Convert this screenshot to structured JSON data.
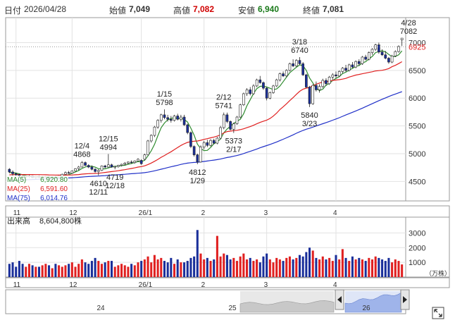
{
  "header": {
    "date_label": "日付",
    "date": "2026/04/28",
    "open_label": "始値",
    "open": "7,049",
    "high_label": "高値",
    "high": "7,082",
    "low_label": "安値",
    "low": "6,940",
    "close_label": "終値",
    "close": "7,081"
  },
  "colors": {
    "ma5": "#2e8b2e",
    "ma25": "#e02020",
    "ma75": "#2030c8",
    "up_candle": "#ffffff",
    "down_candle": "#1a2f9a",
    "volume_up": "#e02020",
    "volume_down": "#1a2f9a",
    "current_price": "#e02020"
  },
  "legend": [
    {
      "label": "MA(5)",
      "value": "6,920.80",
      "color": "#2e8b2e"
    },
    {
      "label": "MA(25)",
      "value": "6,591.60",
      "color": "#e02020"
    },
    {
      "label": "MA(75)",
      "value": "6,014.76",
      "color": "#2030c8"
    }
  ],
  "current_price_label": "6925",
  "volume_label": "出来高",
  "volume_value": "8,604,800株",
  "volume_unit": "（万株）",
  "navigator": {
    "labels": [
      "24",
      "25",
      "26"
    ]
  },
  "chart_data": {
    "type": "candlestick",
    "price_axis": {
      "ticks": [
        4500,
        5000,
        5500,
        6000,
        6500,
        7000
      ],
      "range": [
        4150,
        7450
      ]
    },
    "volume_axis": {
      "ticks": [
        1000,
        2000,
        3000
      ],
      "range": [
        0,
        3500
      ],
      "unit": "万株"
    },
    "x_axis": {
      "tick_labels": [
        {
          "label": "11",
          "index": 2
        },
        {
          "label": "12",
          "index": 19
        },
        {
          "label": "26/1",
          "index": 40
        },
        {
          "label": "2",
          "index": 59
        },
        {
          "label": "3",
          "index": 78
        },
        {
          "label": "4",
          "index": 99
        }
      ]
    },
    "annotations": [
      {
        "index": 22,
        "price": 4868,
        "date": "12/4",
        "type": "high"
      },
      {
        "index": 30,
        "price": 4994,
        "date": "12/15",
        "type": "high"
      },
      {
        "index": 27,
        "price": 4610,
        "date": "12/11",
        "type": "low"
      },
      {
        "index": 32,
        "price": 4719,
        "date": "12/18",
        "type": "low"
      },
      {
        "index": 47,
        "price": 5798,
        "date": "1/15",
        "type": "high"
      },
      {
        "index": 57,
        "price": 4812,
        "date": "1/29",
        "type": "low"
      },
      {
        "index": 65,
        "price": 5741,
        "date": "2/12",
        "type": "high"
      },
      {
        "index": 68,
        "price": 5373,
        "date": "2/17",
        "type": "low"
      },
      {
        "index": 88,
        "price": 6740,
        "date": "3/18",
        "type": "high"
      },
      {
        "index": 91,
        "price": 5840,
        "date": "3/23",
        "type": "low"
      },
      {
        "index": 121,
        "price": 7082,
        "date": "4/28",
        "type": "high"
      }
    ],
    "series": [
      {
        "name": "MA(5)",
        "values": []
      },
      {
        "name": "MA(25)",
        "values": []
      },
      {
        "name": "MA(75)",
        "values": []
      }
    ],
    "candles": [
      {
        "o": 4720,
        "h": 4740,
        "l": 4650,
        "c": 4670,
        "v": 900
      },
      {
        "o": 4670,
        "h": 4700,
        "l": 4600,
        "c": 4640,
        "v": 1000
      },
      {
        "o": 4640,
        "h": 4660,
        "l": 4590,
        "c": 4620,
        "v": 700
      },
      {
        "o": 4620,
        "h": 4640,
        "l": 4570,
        "c": 4590,
        "v": 1100
      },
      {
        "o": 4590,
        "h": 4610,
        "l": 4550,
        "c": 4580,
        "v": 900
      },
      {
        "o": 4580,
        "h": 4600,
        "l": 4560,
        "c": 4590,
        "v": 700
      },
      {
        "o": 4590,
        "h": 4620,
        "l": 4560,
        "c": 4600,
        "v": 900
      },
      {
        "o": 4600,
        "h": 4610,
        "l": 4560,
        "c": 4570,
        "v": 800
      },
      {
        "o": 4570,
        "h": 4600,
        "l": 4550,
        "c": 4590,
        "v": 700
      },
      {
        "o": 4590,
        "h": 4610,
        "l": 4560,
        "c": 4575,
        "v": 700
      },
      {
        "o": 4575,
        "h": 4600,
        "l": 4555,
        "c": 4580,
        "v": 800
      },
      {
        "o": 4580,
        "h": 4600,
        "l": 4560,
        "c": 4585,
        "v": 900
      },
      {
        "o": 4585,
        "h": 4600,
        "l": 4560,
        "c": 4570,
        "v": 800
      },
      {
        "o": 4570,
        "h": 4590,
        "l": 4550,
        "c": 4580,
        "v": 600
      },
      {
        "o": 4580,
        "h": 4600,
        "l": 4560,
        "c": 4575,
        "v": 900
      },
      {
        "o": 4575,
        "h": 4610,
        "l": 4560,
        "c": 4600,
        "v": 800
      },
      {
        "o": 4600,
        "h": 4640,
        "l": 4580,
        "c": 4630,
        "v": 700
      },
      {
        "o": 4630,
        "h": 4680,
        "l": 4620,
        "c": 4660,
        "v": 800
      },
      {
        "o": 4660,
        "h": 4690,
        "l": 4640,
        "c": 4650,
        "v": 900
      },
      {
        "o": 4650,
        "h": 4700,
        "l": 4640,
        "c": 4690,
        "v": 1000
      },
      {
        "o": 4690,
        "h": 4740,
        "l": 4680,
        "c": 4730,
        "v": 700
      },
      {
        "o": 4730,
        "h": 4780,
        "l": 4700,
        "c": 4760,
        "v": 900
      },
      {
        "o": 4760,
        "h": 4868,
        "l": 4750,
        "c": 4840,
        "v": 1200
      },
      {
        "o": 4840,
        "h": 4860,
        "l": 4780,
        "c": 4790,
        "v": 1000
      },
      {
        "o": 4790,
        "h": 4810,
        "l": 4740,
        "c": 4760,
        "v": 900
      },
      {
        "o": 4760,
        "h": 4790,
        "l": 4700,
        "c": 4720,
        "v": 1100
      },
      {
        "o": 4720,
        "h": 4740,
        "l": 4660,
        "c": 4680,
        "v": 1300
      },
      {
        "o": 4680,
        "h": 4720,
        "l": 4610,
        "c": 4700,
        "v": 1100
      },
      {
        "o": 4700,
        "h": 4790,
        "l": 4690,
        "c": 4780,
        "v": 900
      },
      {
        "o": 4780,
        "h": 4800,
        "l": 4740,
        "c": 4760,
        "v": 1000
      },
      {
        "o": 4760,
        "h": 4994,
        "l": 4750,
        "c": 4800,
        "v": 1100
      },
      {
        "o": 4800,
        "h": 4820,
        "l": 4750,
        "c": 4760,
        "v": 1100
      },
      {
        "o": 4760,
        "h": 4780,
        "l": 4719,
        "c": 4770,
        "v": 700
      },
      {
        "o": 4770,
        "h": 4800,
        "l": 4750,
        "c": 4790,
        "v": 800
      },
      {
        "o": 4790,
        "h": 4820,
        "l": 4770,
        "c": 4810,
        "v": 900
      },
      {
        "o": 4810,
        "h": 4850,
        "l": 4790,
        "c": 4830,
        "v": 800
      },
      {
        "o": 4830,
        "h": 4860,
        "l": 4810,
        "c": 4850,
        "v": 700
      },
      {
        "o": 4850,
        "h": 4880,
        "l": 4820,
        "c": 4840,
        "v": 900
      },
      {
        "o": 4840,
        "h": 4880,
        "l": 4820,
        "c": 4870,
        "v": 800
      },
      {
        "o": 4870,
        "h": 4920,
        "l": 4860,
        "c": 4900,
        "v": 1000
      },
      {
        "o": 4880,
        "h": 4900,
        "l": 4800,
        "c": 4820,
        "v": 1100
      },
      {
        "o": 4900,
        "h": 5000,
        "l": 4880,
        "c": 4980,
        "v": 1200
      },
      {
        "o": 4980,
        "h": 5250,
        "l": 4970,
        "c": 5230,
        "v": 1400
      },
      {
        "o": 5230,
        "h": 5350,
        "l": 5200,
        "c": 5330,
        "v": 1000
      },
      {
        "o": 5330,
        "h": 5500,
        "l": 5300,
        "c": 5480,
        "v": 1500
      },
      {
        "o": 5480,
        "h": 5620,
        "l": 5450,
        "c": 5600,
        "v": 1200
      },
      {
        "o": 5600,
        "h": 5720,
        "l": 5560,
        "c": 5700,
        "v": 1300
      },
      {
        "o": 5700,
        "h": 5798,
        "l": 5620,
        "c": 5650,
        "v": 1100
      },
      {
        "o": 5650,
        "h": 5700,
        "l": 5580,
        "c": 5620,
        "v": 1000
      },
      {
        "o": 5620,
        "h": 5680,
        "l": 5560,
        "c": 5600,
        "v": 1300
      },
      {
        "o": 5600,
        "h": 5700,
        "l": 5580,
        "c": 5680,
        "v": 900
      },
      {
        "o": 5680,
        "h": 5720,
        "l": 5600,
        "c": 5620,
        "v": 1200
      },
      {
        "o": 5620,
        "h": 5700,
        "l": 5580,
        "c": 5660,
        "v": 1000
      },
      {
        "o": 5660,
        "h": 5700,
        "l": 5500,
        "c": 5520,
        "v": 1000
      },
      {
        "o": 5520,
        "h": 5540,
        "l": 5350,
        "c": 5380,
        "v": 1100
      },
      {
        "o": 5380,
        "h": 5400,
        "l": 5100,
        "c": 5130,
        "v": 1300
      },
      {
        "o": 5130,
        "h": 5150,
        "l": 4950,
        "c": 4980,
        "v": 1400
      },
      {
        "o": 4980,
        "h": 5000,
        "l": 4812,
        "c": 4850,
        "v": 3200
      },
      {
        "o": 4850,
        "h": 5150,
        "l": 4840,
        "c": 5120,
        "v": 1600
      },
      {
        "o": 5120,
        "h": 5230,
        "l": 5080,
        "c": 5200,
        "v": 1200
      },
      {
        "o": 5200,
        "h": 5250,
        "l": 5120,
        "c": 5150,
        "v": 1300
      },
      {
        "o": 5150,
        "h": 5260,
        "l": 5130,
        "c": 5240,
        "v": 1100
      },
      {
        "o": 5240,
        "h": 5270,
        "l": 5170,
        "c": 5190,
        "v": 1200
      },
      {
        "o": 5190,
        "h": 5300,
        "l": 5170,
        "c": 5280,
        "v": 2800
      },
      {
        "o": 5280,
        "h": 5500,
        "l": 5260,
        "c": 5470,
        "v": 1400
      },
      {
        "o": 5470,
        "h": 5741,
        "l": 5440,
        "c": 5700,
        "v": 1600
      },
      {
        "o": 5700,
        "h": 5740,
        "l": 5550,
        "c": 5580,
        "v": 1500
      },
      {
        "o": 5580,
        "h": 5600,
        "l": 5420,
        "c": 5440,
        "v": 1200
      },
      {
        "o": 5440,
        "h": 5560,
        "l": 5373,
        "c": 5540,
        "v": 1300
      },
      {
        "o": 5540,
        "h": 5680,
        "l": 5520,
        "c": 5660,
        "v": 1100
      },
      {
        "o": 5660,
        "h": 5900,
        "l": 5640,
        "c": 5880,
        "v": 1400
      },
      {
        "o": 5880,
        "h": 6100,
        "l": 5860,
        "c": 6080,
        "v": 1600
      },
      {
        "o": 6080,
        "h": 6180,
        "l": 6040,
        "c": 6150,
        "v": 1200
      },
      {
        "o": 6150,
        "h": 6200,
        "l": 6050,
        "c": 6080,
        "v": 1300
      },
      {
        "o": 6080,
        "h": 6250,
        "l": 6060,
        "c": 6220,
        "v": 1100
      },
      {
        "o": 6220,
        "h": 6350,
        "l": 6200,
        "c": 6330,
        "v": 1200
      },
      {
        "o": 6330,
        "h": 6400,
        "l": 6260,
        "c": 6280,
        "v": 1000
      },
      {
        "o": 6280,
        "h": 6300,
        "l": 6150,
        "c": 6180,
        "v": 1400
      },
      {
        "o": 6180,
        "h": 6200,
        "l": 5960,
        "c": 6000,
        "v": 1600
      },
      {
        "o": 6000,
        "h": 6120,
        "l": 5980,
        "c": 6100,
        "v": 1200
      },
      {
        "o": 6100,
        "h": 6240,
        "l": 6080,
        "c": 6220,
        "v": 1000
      },
      {
        "o": 6220,
        "h": 6350,
        "l": 6200,
        "c": 6330,
        "v": 1300
      },
      {
        "o": 6330,
        "h": 6460,
        "l": 6300,
        "c": 6440,
        "v": 1200
      },
      {
        "o": 6440,
        "h": 6480,
        "l": 6380,
        "c": 6400,
        "v": 1100
      },
      {
        "o": 6400,
        "h": 6520,
        "l": 6380,
        "c": 6500,
        "v": 1300
      },
      {
        "o": 6500,
        "h": 6640,
        "l": 6480,
        "c": 6620,
        "v": 1400
      },
      {
        "o": 6620,
        "h": 6700,
        "l": 6560,
        "c": 6580,
        "v": 1200
      },
      {
        "o": 6580,
        "h": 6700,
        "l": 6560,
        "c": 6680,
        "v": 1300
      },
      {
        "o": 6680,
        "h": 6740,
        "l": 6600,
        "c": 6620,
        "v": 1500
      },
      {
        "o": 6620,
        "h": 6650,
        "l": 6400,
        "c": 6420,
        "v": 1400
      },
      {
        "o": 6420,
        "h": 6440,
        "l": 6180,
        "c": 6200,
        "v": 1700
      },
      {
        "o": 6200,
        "h": 6220,
        "l": 5840,
        "c": 5900,
        "v": 2000
      },
      {
        "o": 5900,
        "h": 6250,
        "l": 5880,
        "c": 6230,
        "v": 1800
      },
      {
        "o": 6230,
        "h": 6300,
        "l": 6120,
        "c": 6150,
        "v": 1300
      },
      {
        "o": 6150,
        "h": 6250,
        "l": 6100,
        "c": 6210,
        "v": 1200
      },
      {
        "o": 6210,
        "h": 6350,
        "l": 6180,
        "c": 6320,
        "v": 1400
      },
      {
        "o": 6320,
        "h": 6360,
        "l": 6220,
        "c": 6260,
        "v": 1200
      },
      {
        "o": 6260,
        "h": 6400,
        "l": 6240,
        "c": 6380,
        "v": 1300
      },
      {
        "o": 6380,
        "h": 6450,
        "l": 6330,
        "c": 6420,
        "v": 1100
      },
      {
        "o": 6420,
        "h": 6480,
        "l": 6360,
        "c": 6400,
        "v": 1500
      },
      {
        "o": 6400,
        "h": 6500,
        "l": 6380,
        "c": 6480,
        "v": 1200
      },
      {
        "o": 6480,
        "h": 6560,
        "l": 6450,
        "c": 6540,
        "v": 1900
      },
      {
        "o": 6540,
        "h": 6600,
        "l": 6470,
        "c": 6500,
        "v": 1300
      },
      {
        "o": 6500,
        "h": 6620,
        "l": 6480,
        "c": 6600,
        "v": 1100
      },
      {
        "o": 6600,
        "h": 6650,
        "l": 6540,
        "c": 6560,
        "v": 1400
      },
      {
        "o": 6560,
        "h": 6680,
        "l": 6540,
        "c": 6660,
        "v": 1200
      },
      {
        "o": 6660,
        "h": 6700,
        "l": 6580,
        "c": 6620,
        "v": 1300
      },
      {
        "o": 6620,
        "h": 6760,
        "l": 6600,
        "c": 6740,
        "v": 1200
      },
      {
        "o": 6740,
        "h": 6780,
        "l": 6680,
        "c": 6700,
        "v": 1100
      },
      {
        "o": 6700,
        "h": 6840,
        "l": 6680,
        "c": 6820,
        "v": 1300
      },
      {
        "o": 6820,
        "h": 6900,
        "l": 6780,
        "c": 6880,
        "v": 1200
      },
      {
        "o": 6880,
        "h": 6980,
        "l": 6850,
        "c": 6960,
        "v": 1400
      },
      {
        "o": 6960,
        "h": 7000,
        "l": 6800,
        "c": 6830,
        "v": 1300
      },
      {
        "o": 6830,
        "h": 6880,
        "l": 6760,
        "c": 6780,
        "v": 1200
      },
      {
        "o": 6780,
        "h": 6850,
        "l": 6700,
        "c": 6720,
        "v": 1100
      },
      {
        "o": 6720,
        "h": 6740,
        "l": 6620,
        "c": 6650,
        "v": 1300
      },
      {
        "o": 6650,
        "h": 6780,
        "l": 6630,
        "c": 6760,
        "v": 1000
      },
      {
        "o": 6760,
        "h": 6860,
        "l": 6740,
        "c": 6840,
        "v": 1200
      },
      {
        "o": 6840,
        "h": 6950,
        "l": 6820,
        "c": 6930,
        "v": 1100
      },
      {
        "o": 7049,
        "h": 7082,
        "l": 6940,
        "c": 7081,
        "v": 860
      }
    ]
  }
}
